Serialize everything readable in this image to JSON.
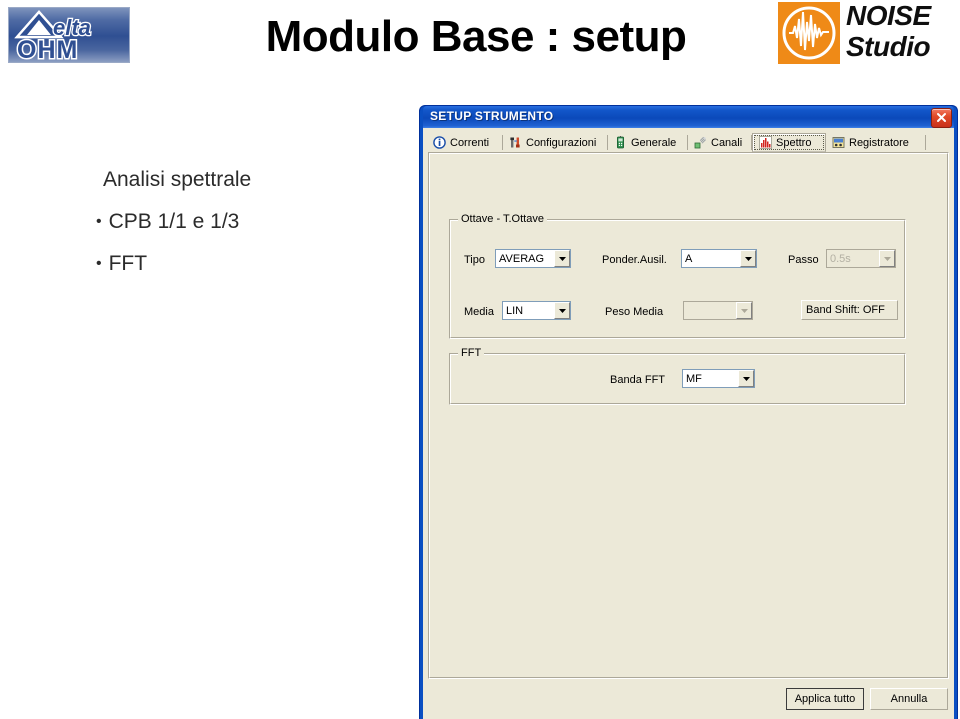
{
  "slide": {
    "title": "Modulo Base : setup",
    "brand_logo": {
      "line1": "elta",
      "line2": "OHM",
      "name": "delta-ohm-logo"
    },
    "product_logo": {
      "line1": "NOISE",
      "line2": "Studio"
    },
    "bullets": {
      "lead": "Analisi spettrale",
      "items": [
        "CPB 1/1 e 1/3",
        "FFT"
      ],
      "bullet_glyph": "•"
    }
  },
  "dialog": {
    "title": "SETUP STRUMENTO",
    "close_icon": "close-icon",
    "tabs": [
      {
        "label": "Correnti",
        "icon": "info-icon",
        "active": false
      },
      {
        "label": "Configurazioni",
        "icon": "tools-icon",
        "active": false
      },
      {
        "label": "Generale",
        "icon": "device-icon",
        "active": false
      },
      {
        "label": "Canali",
        "icon": "channels-icon",
        "active": false
      },
      {
        "label": "Spettro",
        "icon": "bar-chart-icon",
        "active": true
      },
      {
        "label": "Registratore",
        "icon": "recorder-icon",
        "active": false
      }
    ],
    "groups": {
      "ottave": {
        "title": "Ottave - T.Ottave",
        "tipo": {
          "label": "Tipo",
          "value": "AVERAG",
          "disabled": false
        },
        "ponder_ausil": {
          "label": "Ponder.Ausil.",
          "value": "A",
          "disabled": false
        },
        "passo": {
          "label": "Passo",
          "value": "0.5s",
          "disabled": true
        },
        "media": {
          "label": "Media",
          "value": "LIN",
          "disabled": false
        },
        "peso_media": {
          "label": "Peso Media",
          "value": "",
          "disabled": true
        },
        "band_shift": {
          "label": "Band Shift: OFF"
        }
      },
      "fft": {
        "title": "FFT",
        "banda_fft": {
          "label": "Banda FFT",
          "value": "MF",
          "disabled": false
        }
      }
    },
    "buttons": {
      "apply_all": "Applica tutto",
      "cancel": "Annulla"
    }
  },
  "colors": {
    "titlebar_blue": "#0a4fc2",
    "dialog_face": "#ece9d8",
    "close_red": "#c8301a",
    "brand_orange": "#ef8a17",
    "logo_blue": "#2f4f92"
  }
}
